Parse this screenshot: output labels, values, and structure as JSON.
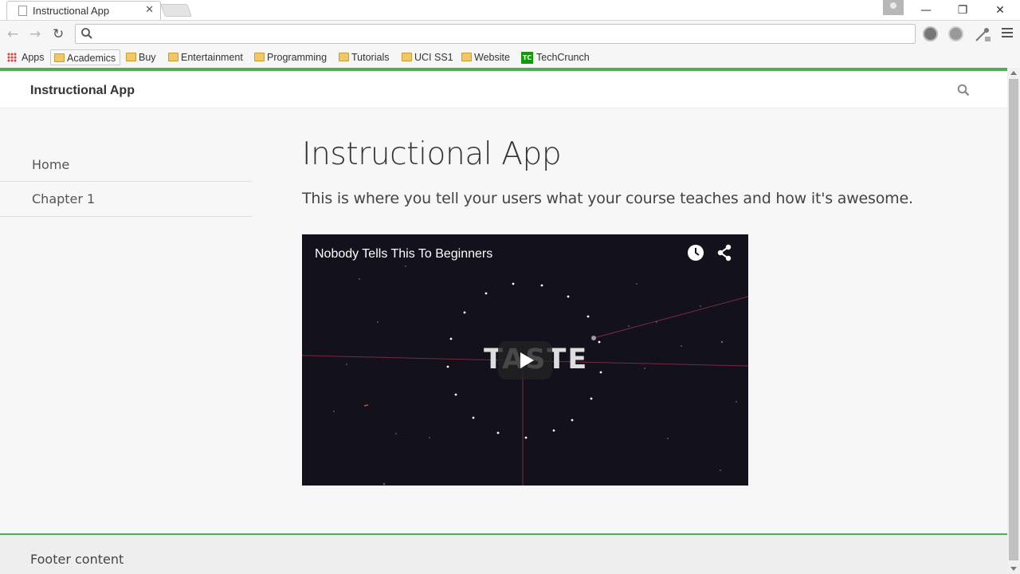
{
  "browser": {
    "tab_title": "Instructional App",
    "tab_close_glyph": "✕",
    "window_controls": {
      "minimize": "—",
      "restore": "❐",
      "close": "✕"
    },
    "address_value": "",
    "bookmarks": [
      {
        "label": "Apps",
        "icon": "apps-grid-icon"
      },
      {
        "label": "Academics",
        "icon": "folder-icon"
      },
      {
        "label": "Buy",
        "icon": "folder-icon"
      },
      {
        "label": "Entertainment",
        "icon": "folder-icon"
      },
      {
        "label": "Programming",
        "icon": "folder-icon"
      },
      {
        "label": "Tutorials",
        "icon": "folder-icon"
      },
      {
        "label": "UCI SS1",
        "icon": "folder-icon"
      },
      {
        "label": "Website",
        "icon": "folder-icon"
      },
      {
        "label": "TechCrunch",
        "icon": "techcrunch-icon",
        "icon_text": "TC"
      }
    ]
  },
  "header": {
    "brand": "Instructional App"
  },
  "sidebar": {
    "items": [
      {
        "label": "Home"
      },
      {
        "label": "Chapter 1"
      }
    ]
  },
  "main": {
    "title": "Instructional App",
    "lead": "This is where you tell your users what your course teaches and how it's awesome."
  },
  "video": {
    "title": "Nobody Tells This To Beginners",
    "overlay_word": "TASTE"
  },
  "footer": {
    "text": "Footer content"
  },
  "colors": {
    "accent": "#4caf50",
    "video_bg": "#13111c"
  }
}
